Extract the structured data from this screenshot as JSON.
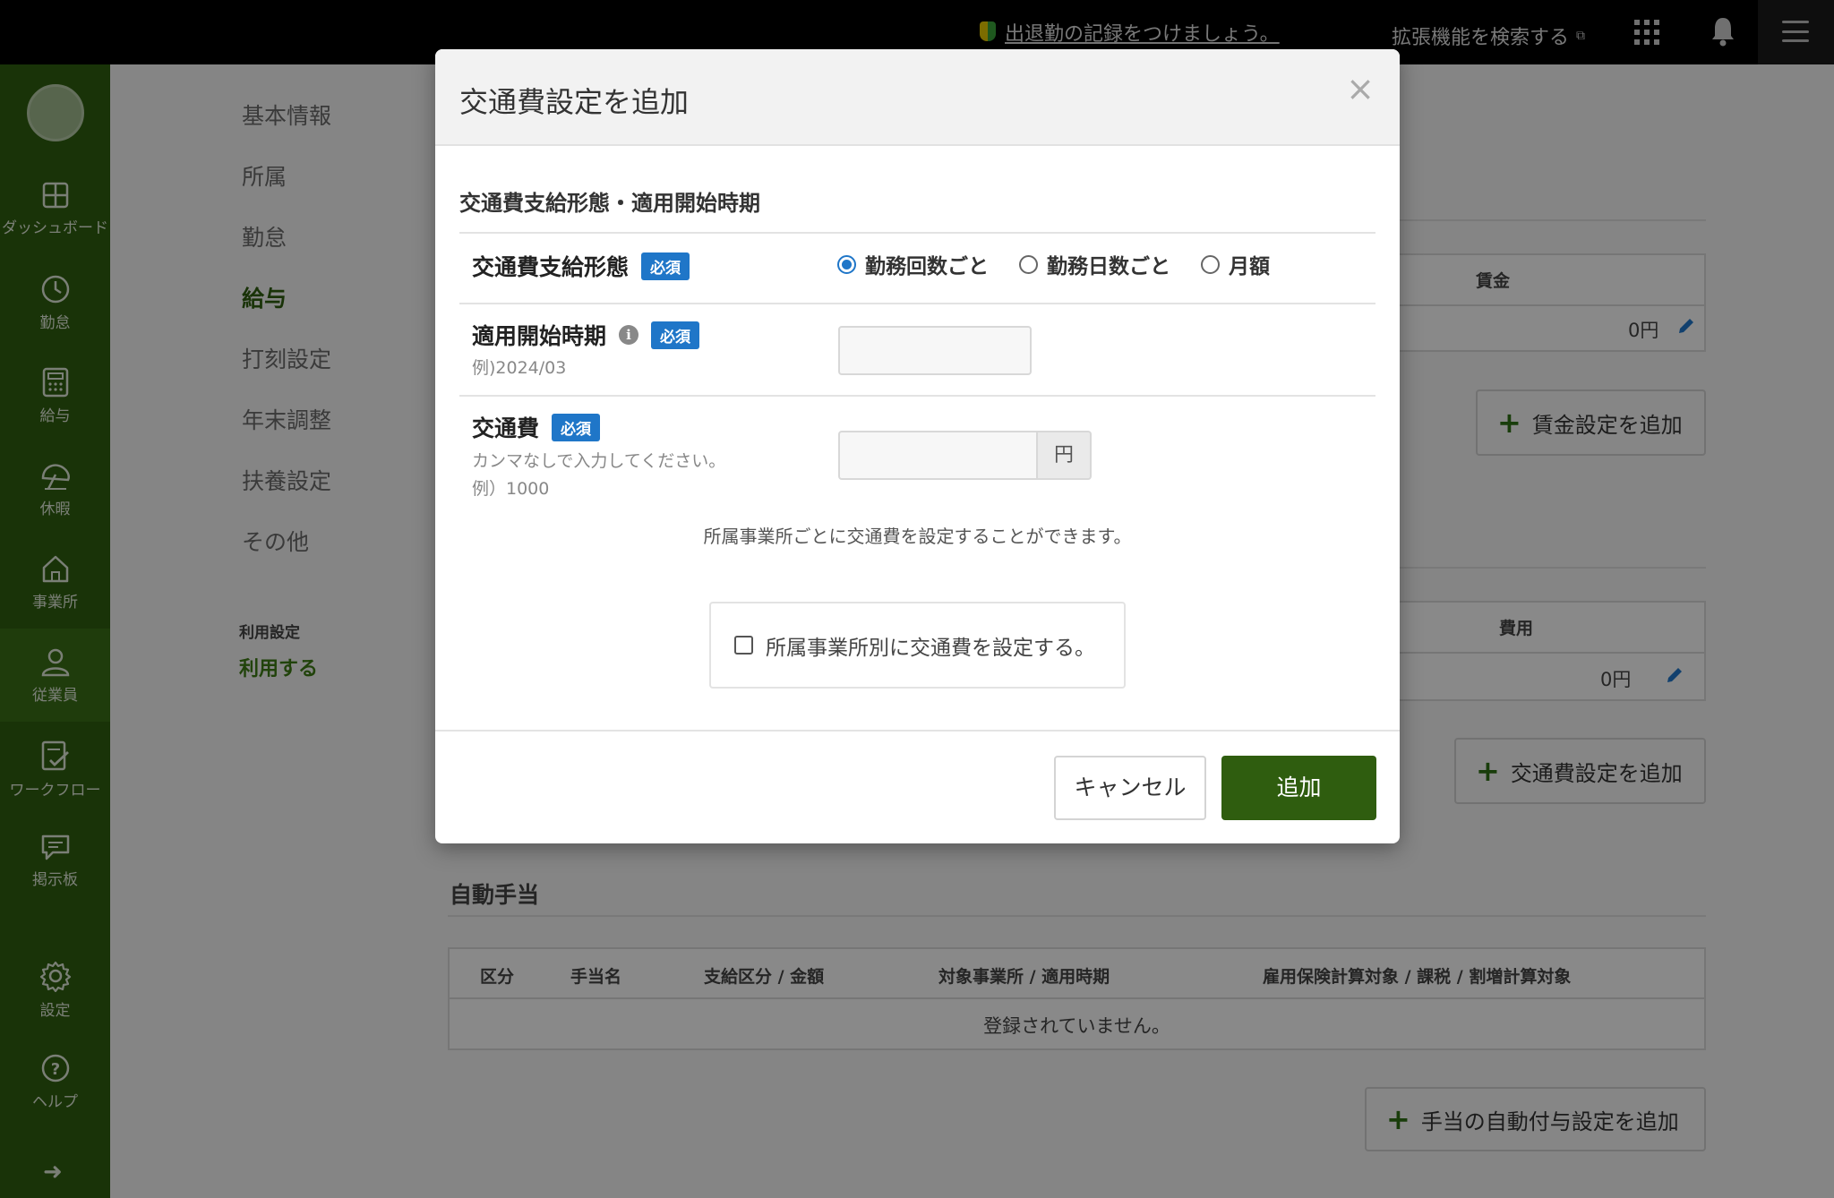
{
  "topbar": {
    "notice_link": "出退勤の記録をつけましょう。",
    "extension_search": "拡張機能を検索する",
    "icons": [
      "beginner-mark-icon",
      "external-link-icon",
      "apps-grid-icon",
      "bell-icon",
      "hamburger-menu-icon"
    ]
  },
  "sidebar": {
    "items": [
      {
        "label": "ダッシュボード",
        "icon": "dashboard-icon"
      },
      {
        "label": "勤怠",
        "icon": "clock-icon"
      },
      {
        "label": "給与",
        "icon": "calculator-icon"
      },
      {
        "label": "休暇",
        "icon": "umbrella-icon"
      },
      {
        "label": "事業所",
        "icon": "home-icon"
      },
      {
        "label": "従業員",
        "icon": "person-icon"
      },
      {
        "label": "ワークフロー",
        "icon": "checklist-icon"
      },
      {
        "label": "掲示板",
        "icon": "chat-icon"
      },
      {
        "label": "設定",
        "icon": "gear-icon"
      },
      {
        "label": "ヘルプ",
        "icon": "help-icon"
      }
    ],
    "active_item": "従業員"
  },
  "settings_nav": {
    "items": [
      "基本情報",
      "所属",
      "勤怠",
      "給与",
      "打刻設定",
      "年末調整",
      "扶養設定",
      "その他"
    ],
    "current": "給与",
    "usage_label": "利用設定",
    "usage_value": "利用する"
  },
  "background": {
    "wage_table": {
      "header": "賃金",
      "value": "0円"
    },
    "add_wage_button": "賃金設定を追加",
    "transport_table": {
      "header": "費用",
      "value": "0円"
    },
    "add_transport_button": "交通費設定を追加",
    "auto_allowance": {
      "title": "自動手当",
      "columns": [
        "区分",
        "手当名",
        "支給区分 / 金額",
        "対象事業所 / 適用時期",
        "雇用保険計算対象 / 課税 / 割増計算対象"
      ],
      "empty_message": "登録されていません。"
    },
    "add_allowance_button": "手当の自動付与設定を追加"
  },
  "modal": {
    "title": "交通費設定を追加",
    "subheading": "交通費支給形態・適用開始時期",
    "required_badge": "必須",
    "payment_type": {
      "label": "交通費支給形態",
      "options": [
        "勤務回数ごと",
        "勤務日数ごと",
        "月額"
      ],
      "selected": "勤務回数ごと"
    },
    "start_period": {
      "label": "適用開始時期",
      "hint": "例)2024/03",
      "value": ""
    },
    "cost": {
      "label": "交通費",
      "hint1": "カンマなしで入力してください。",
      "hint2": "例）1000",
      "value": "",
      "unit": "円"
    },
    "note": "所属事業所ごとに交通費を設定することができます。",
    "checkbox_label": "所属事業所別に交通費を設定する。",
    "checkbox_checked": false,
    "cancel_label": "キャンセル",
    "submit_label": "追加"
  }
}
